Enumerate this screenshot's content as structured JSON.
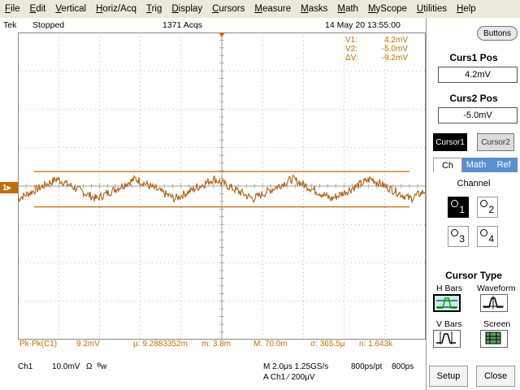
{
  "menu": [
    "File",
    "Edit",
    "Vertical",
    "Horiz/Acq",
    "Trig",
    "Display",
    "Cursors",
    "Measure",
    "Masks",
    "Math",
    "MyScope",
    "Utilities",
    "Help"
  ],
  "status": {
    "brand": "Tek",
    "run_state": "Stopped",
    "acqs": "1371 Acqs",
    "datetime": "14 May 20 13:55:00"
  },
  "cursor_readout": {
    "v1_label": "V1:",
    "v1_value": "4.2mV",
    "v2_label": "V2:",
    "v2_value": "-5.0mV",
    "dv_label": "ΔV:",
    "dv_value": "-9.2mV"
  },
  "channel_marker": "1",
  "measurement": {
    "name": "Pk-Pk(C1)",
    "value": "9.2mV",
    "mu": "μ: 9.2883352m",
    "m": "m: 3.8m",
    "M": "M: 70.0m",
    "sigma": "σ: 365.5μ",
    "n": "n: 1.643k"
  },
  "bottom": {
    "ch": "Ch1",
    "scale": "10.0mV",
    "omega": "Ω",
    "bw": "ᴮw",
    "timebase": "M 2.0μs 1.25GS/s",
    "trigger": "A  Ch1  ⁄  200μV",
    "res1": "800ps/pt",
    "res2": "800ps"
  },
  "panel": {
    "buttons_label": "Buttons",
    "curs1_title": "Curs1 Pos",
    "curs1_value": "4.2mV",
    "curs2_title": "Curs2 Pos",
    "curs2_value": "-5.0mV",
    "cursor1_btn": "Cursor1",
    "cursor2_btn": "Cursor2",
    "tabs": [
      "Ch",
      "Math",
      "Ref"
    ],
    "channel_title": "Channel",
    "channels": [
      "1",
      "2",
      "3",
      "4"
    ],
    "cursor_type_title": "Cursor Type",
    "hbars": "H Bars",
    "waveform": "Waveform",
    "vbars": "V Bars",
    "screen": "Screen",
    "setup": "Setup",
    "close": "Close"
  },
  "colors": {
    "trace": "#b06010",
    "cursor": "#c07000",
    "grid": "#888888",
    "tab_inactive": "#5a8fd0"
  }
}
